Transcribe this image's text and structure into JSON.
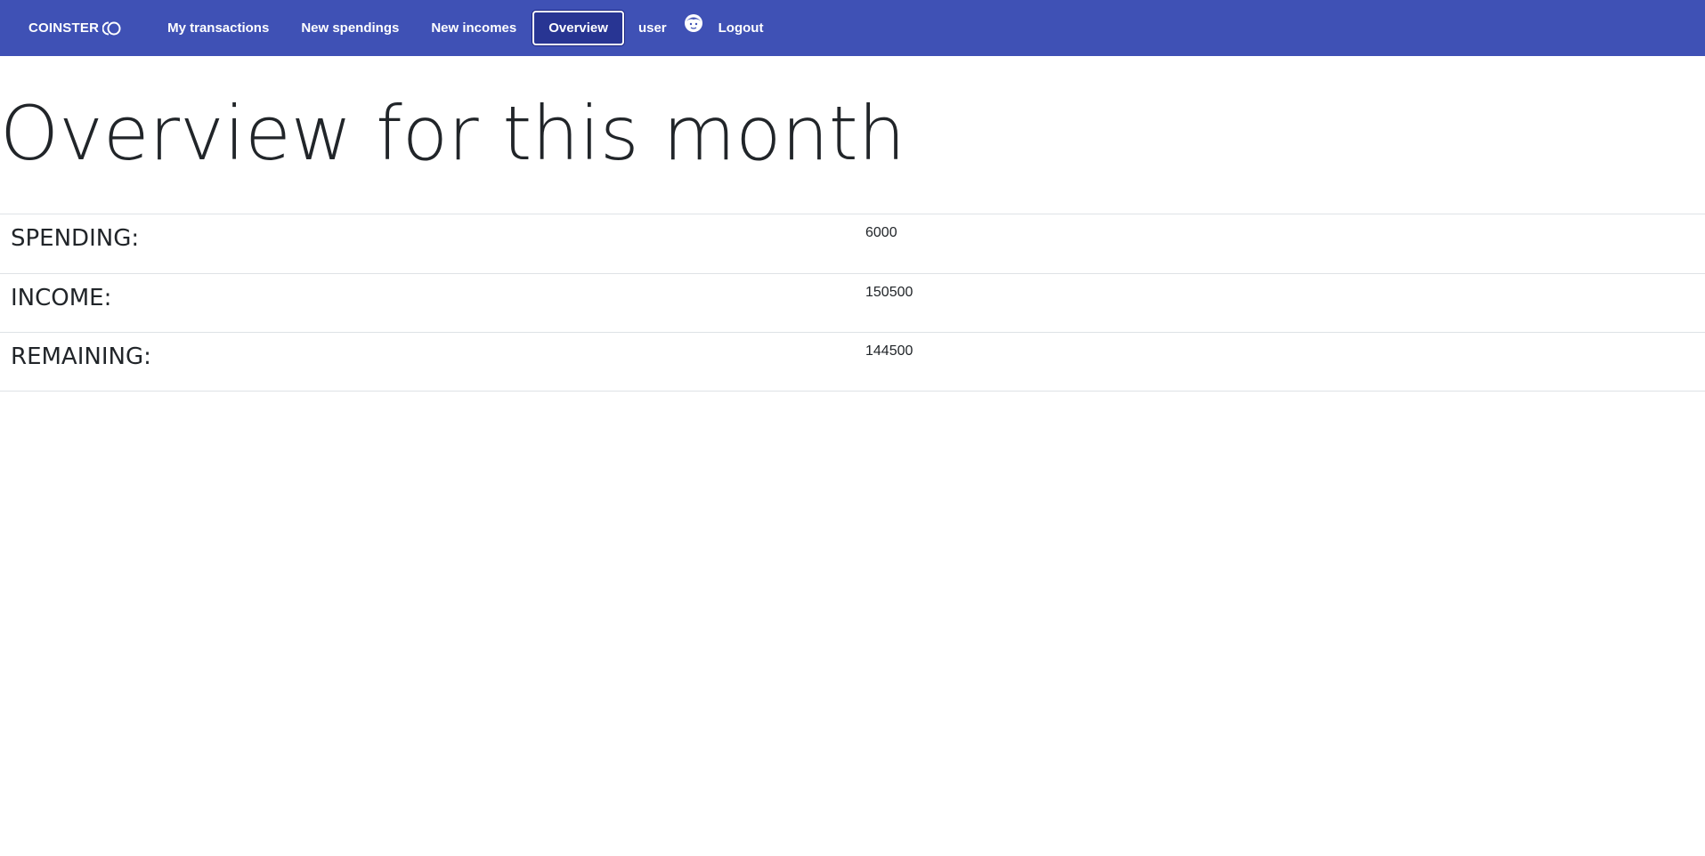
{
  "navbar": {
    "brand": "COINSTER",
    "brand_icon": "coin-logo-icon",
    "links": [
      {
        "label": "My transactions"
      },
      {
        "label": "New spendings"
      },
      {
        "label": "New incomes"
      },
      {
        "label": "Overview",
        "active": true
      }
    ],
    "user_label": "user",
    "avatar_icon": "user-avatar-icon",
    "logout_label": "Logout"
  },
  "page": {
    "title": "Overview for this month"
  },
  "summary": {
    "rows": [
      {
        "label": "SPENDING:",
        "value": "6000"
      },
      {
        "label": "INCOME:",
        "value": "150500"
      },
      {
        "label": "REMAINING:",
        "value": "144500"
      }
    ]
  },
  "colors": {
    "navbar_bg": "#3f51b5",
    "active_link_bg": "#283593",
    "text": "#212529",
    "divider": "#dee2e6"
  }
}
